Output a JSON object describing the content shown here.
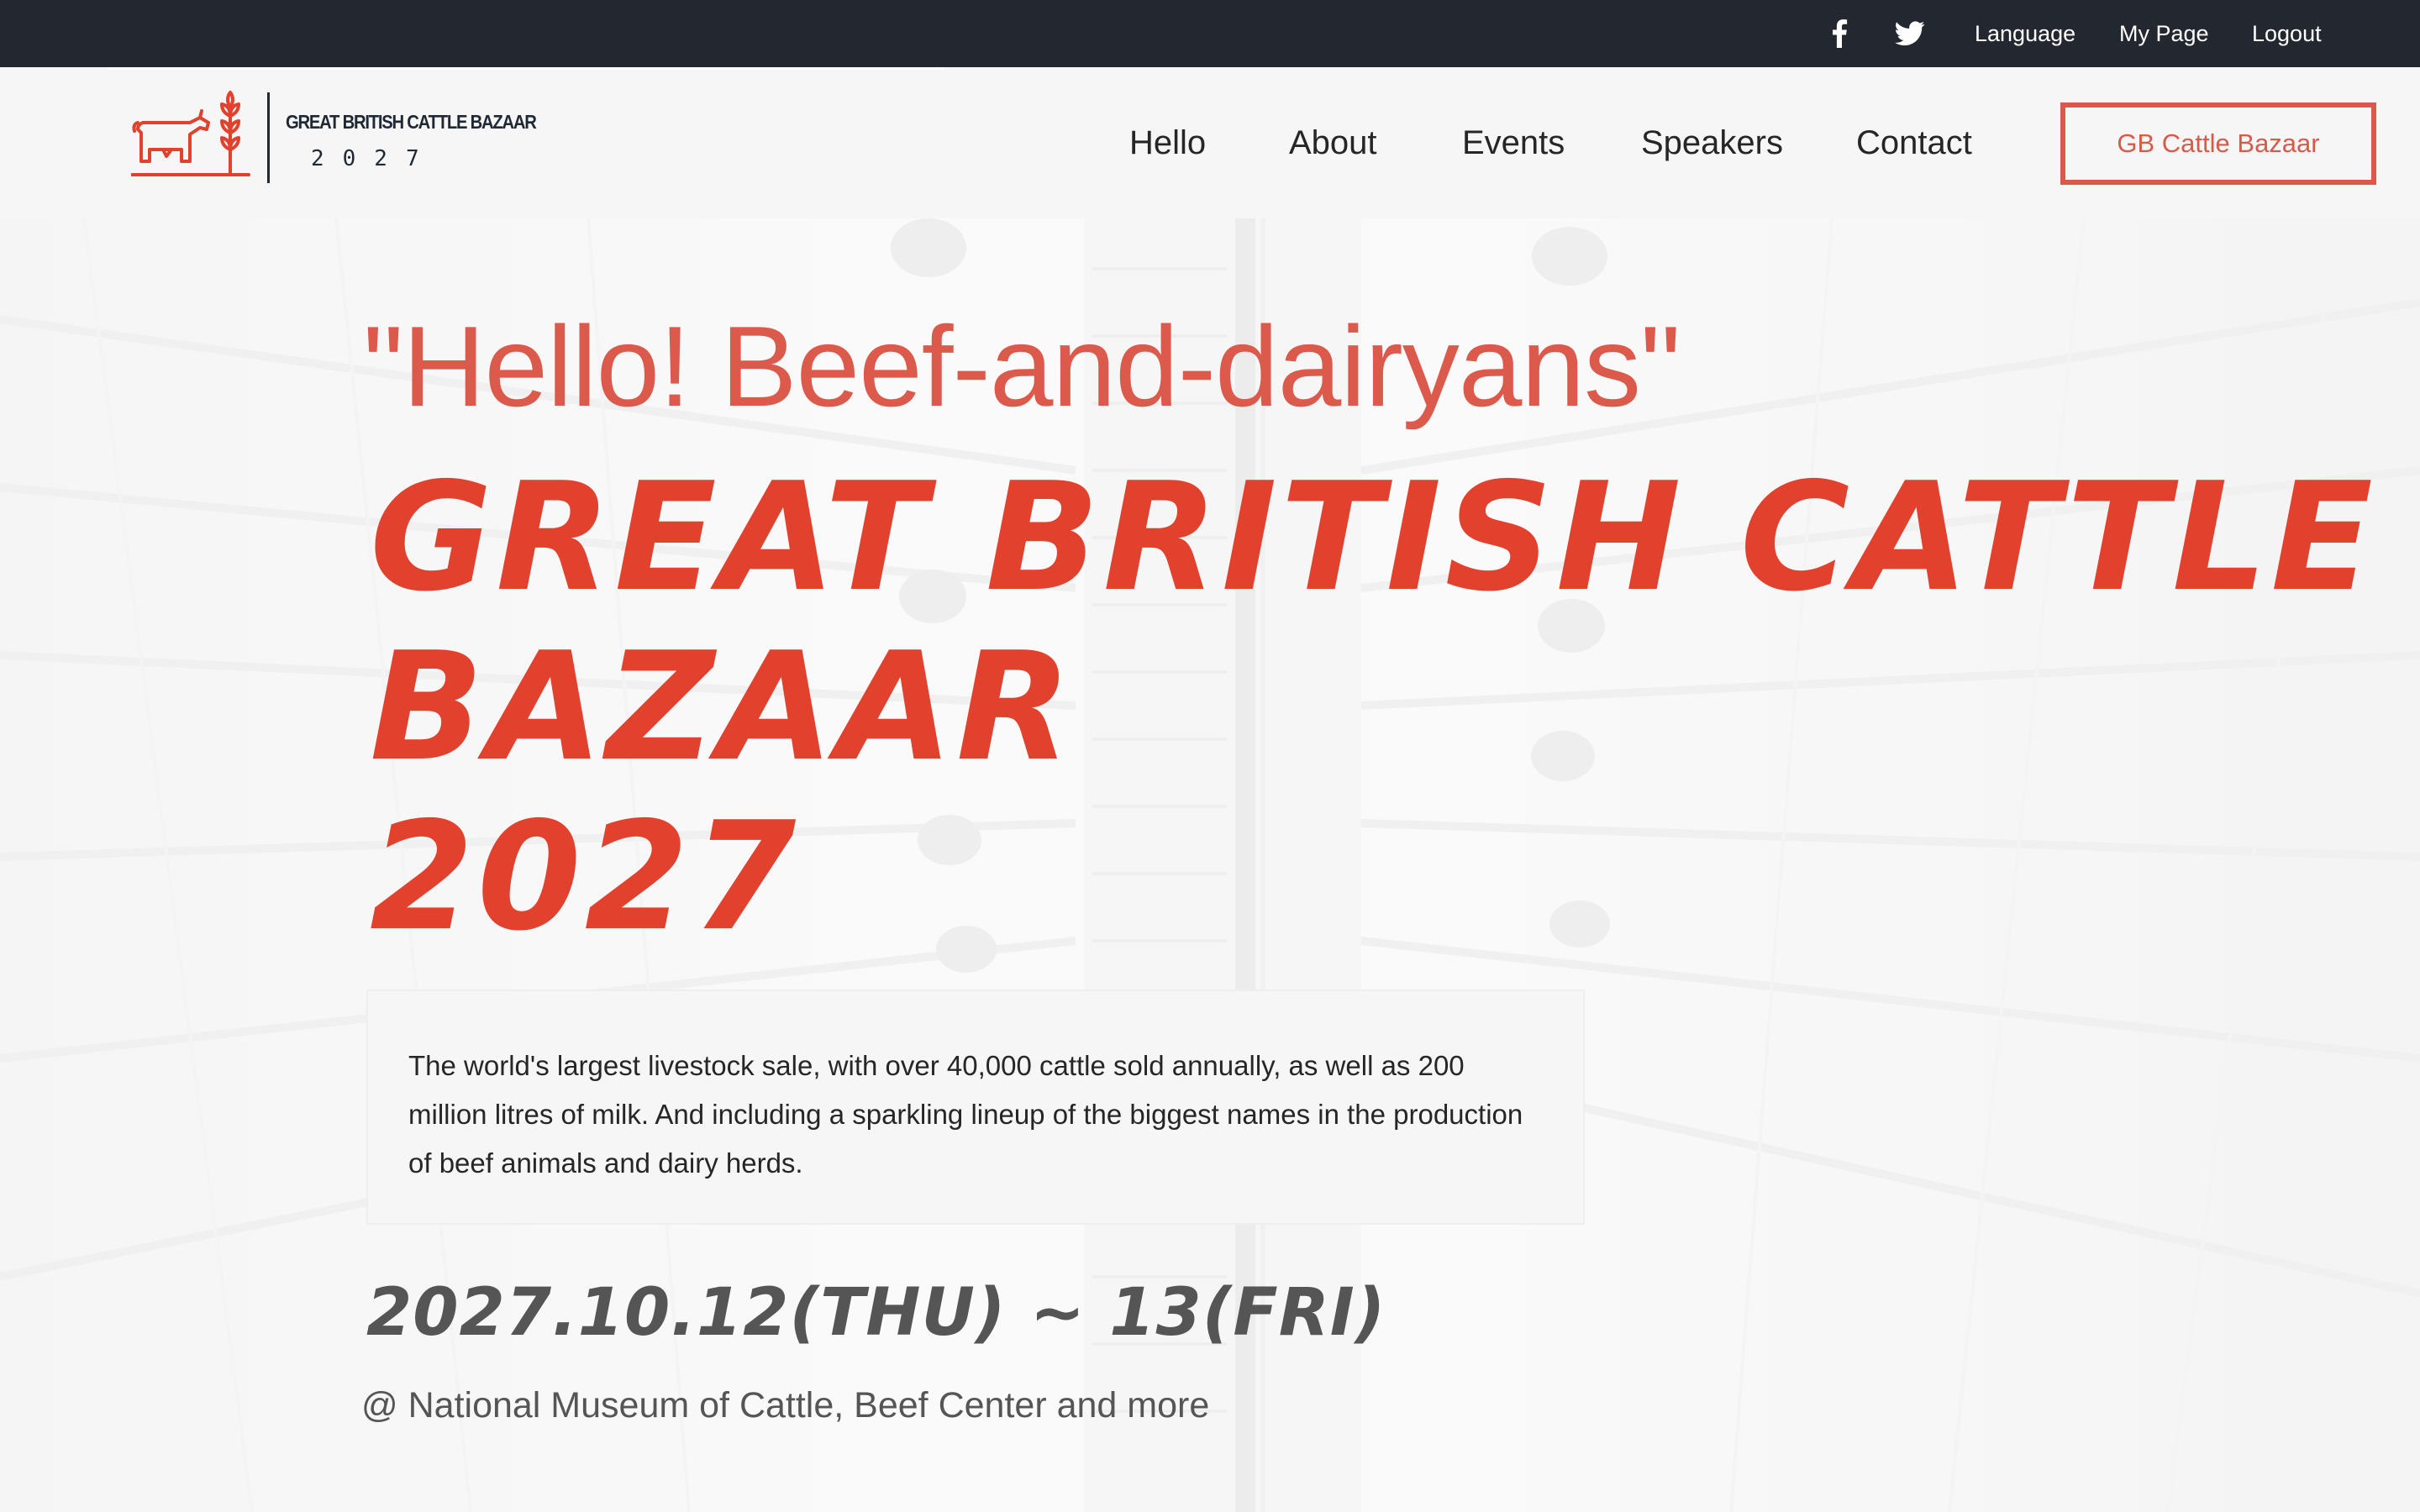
{
  "topbar": {
    "icons": [
      "facebook-icon",
      "twitter-icon"
    ],
    "language": "Language",
    "mypage": "My Page",
    "logout": "Logout"
  },
  "header": {
    "logo_title": "GREAT BRITISH CATTLE BAZAAR",
    "logo_year": "2027",
    "nav": [
      "Hello",
      "About",
      "Events",
      "Speakers",
      "Contact"
    ],
    "cta": "GB Cattle Bazaar"
  },
  "hero": {
    "greeting": "\"Hello! Beef-and-dairyans\"",
    "title_lines": [
      "GREAT BRITISH CATTLE",
      "BAZAAR",
      "2027"
    ],
    "description": "The world's largest livestock sale, with over 40,000 cattle sold annually, as well as 200 million litres of milk. And including a sparkling lineup of the biggest names in the production of beef animals and dairy herds.",
    "date": "2027.10.12(THU) ~ 13(FRI)",
    "venue": "@ National Museum of Cattle, Beef Center and more"
  },
  "colors": {
    "topbar": "#23272f",
    "header_bg": "#f6f6f6",
    "accent": "#e1412d",
    "accent_soft": "#dc5a4b",
    "muted_text": "#555555"
  }
}
